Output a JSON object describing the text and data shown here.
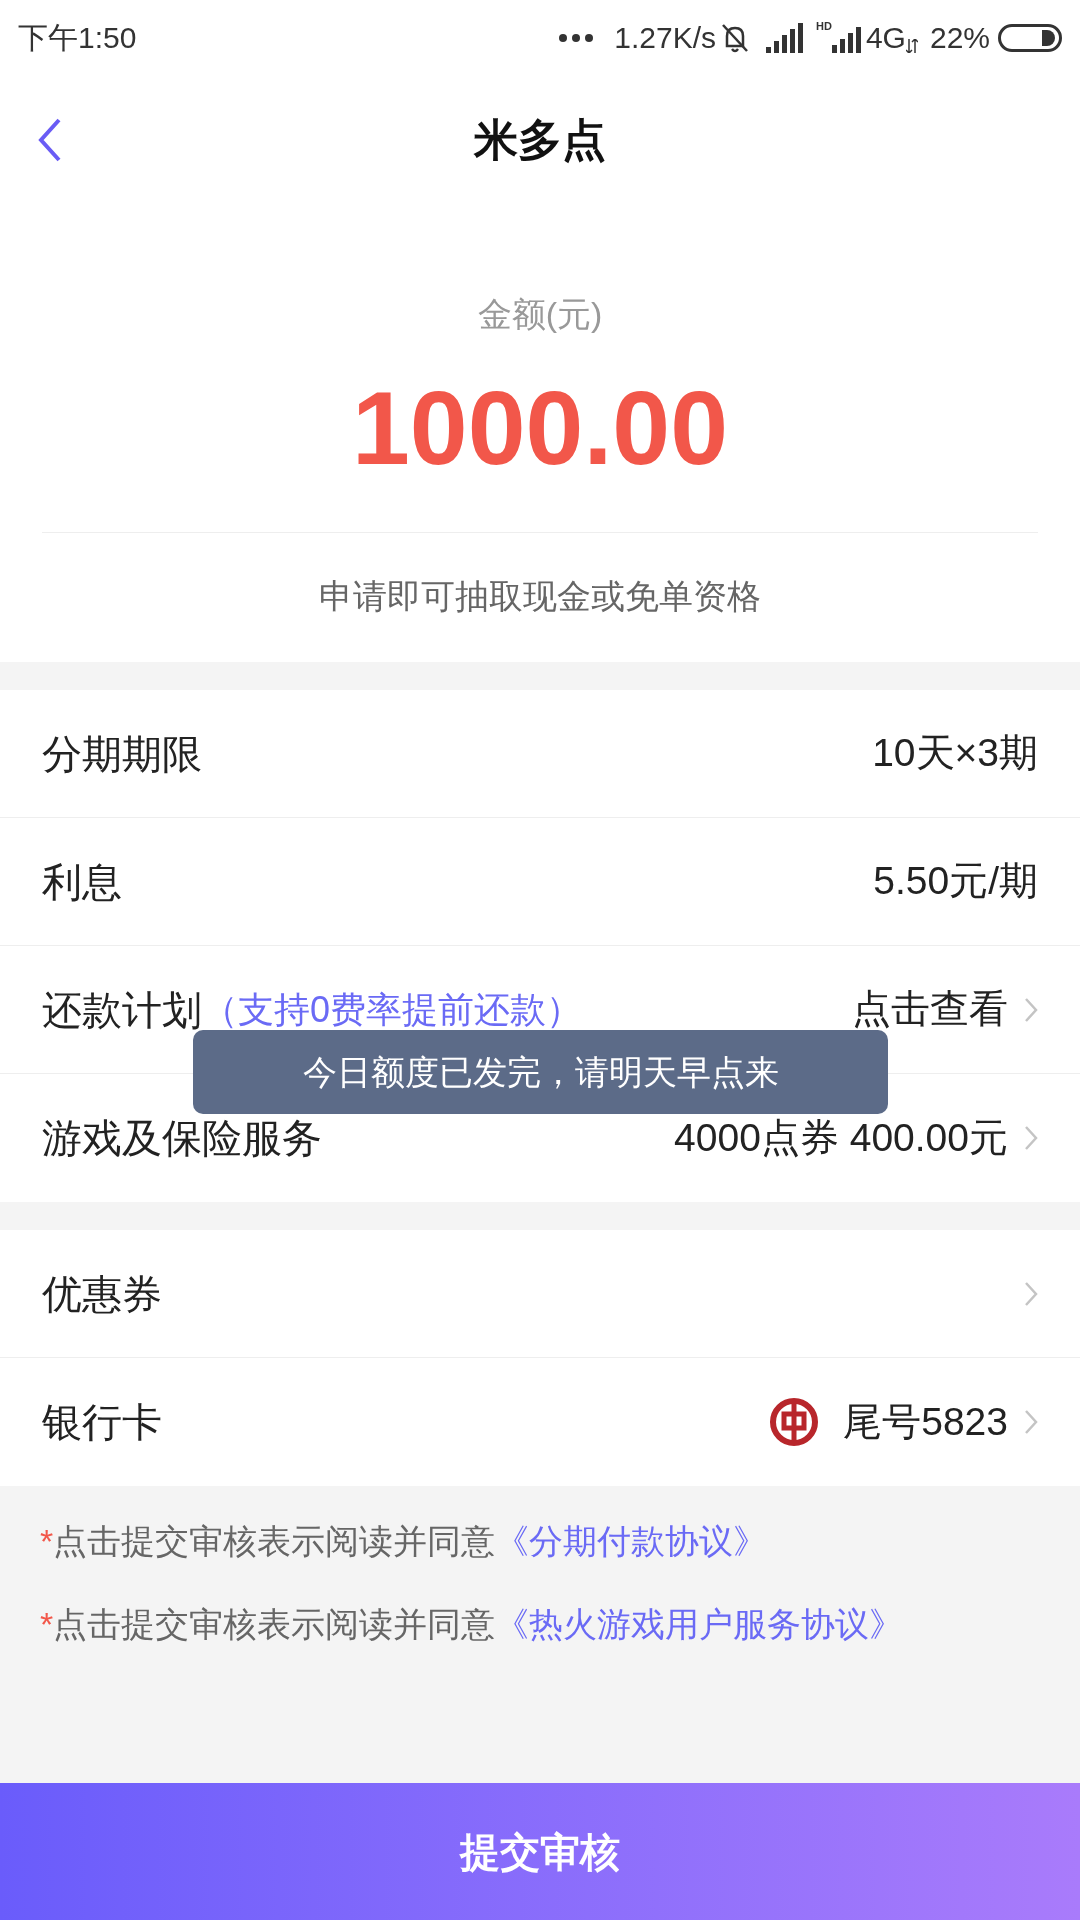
{
  "status_bar": {
    "time": "下午1:50",
    "speed": "1.27K/s",
    "hd": "HD",
    "network": "4G",
    "battery": "22%"
  },
  "header": {
    "title": "米多点"
  },
  "amount": {
    "label": "金额(元)",
    "value": "1000.00",
    "hint": "申请即可抽取现金或免单资格"
  },
  "groups": [
    [
      {
        "kind": "plain",
        "label": "分期期限",
        "value": "10天×3期"
      },
      {
        "kind": "plain",
        "label": "利息",
        "value": "5.50元/期"
      },
      {
        "kind": "link",
        "label": "还款计划",
        "note": "（支持0费率提前还款）",
        "value": "点击查看"
      },
      {
        "kind": "link",
        "label": "游戏及保险服务",
        "value": "4000点券 400.00元"
      }
    ],
    [
      {
        "kind": "link",
        "label": "优惠券"
      },
      {
        "kind": "bank",
        "label": "银行卡",
        "value": "尾号5823"
      }
    ]
  ],
  "agreements": [
    {
      "mark": "*",
      "text": "点击提交审核表示阅读并同意",
      "link": "《分期付款协议》"
    },
    {
      "mark": "*",
      "text": "点击提交审核表示阅读并同意",
      "link": "《热火游戏用户服务协议》"
    }
  ],
  "submit": "提交审核",
  "toast": "今日额度已发完，请明天早点来"
}
